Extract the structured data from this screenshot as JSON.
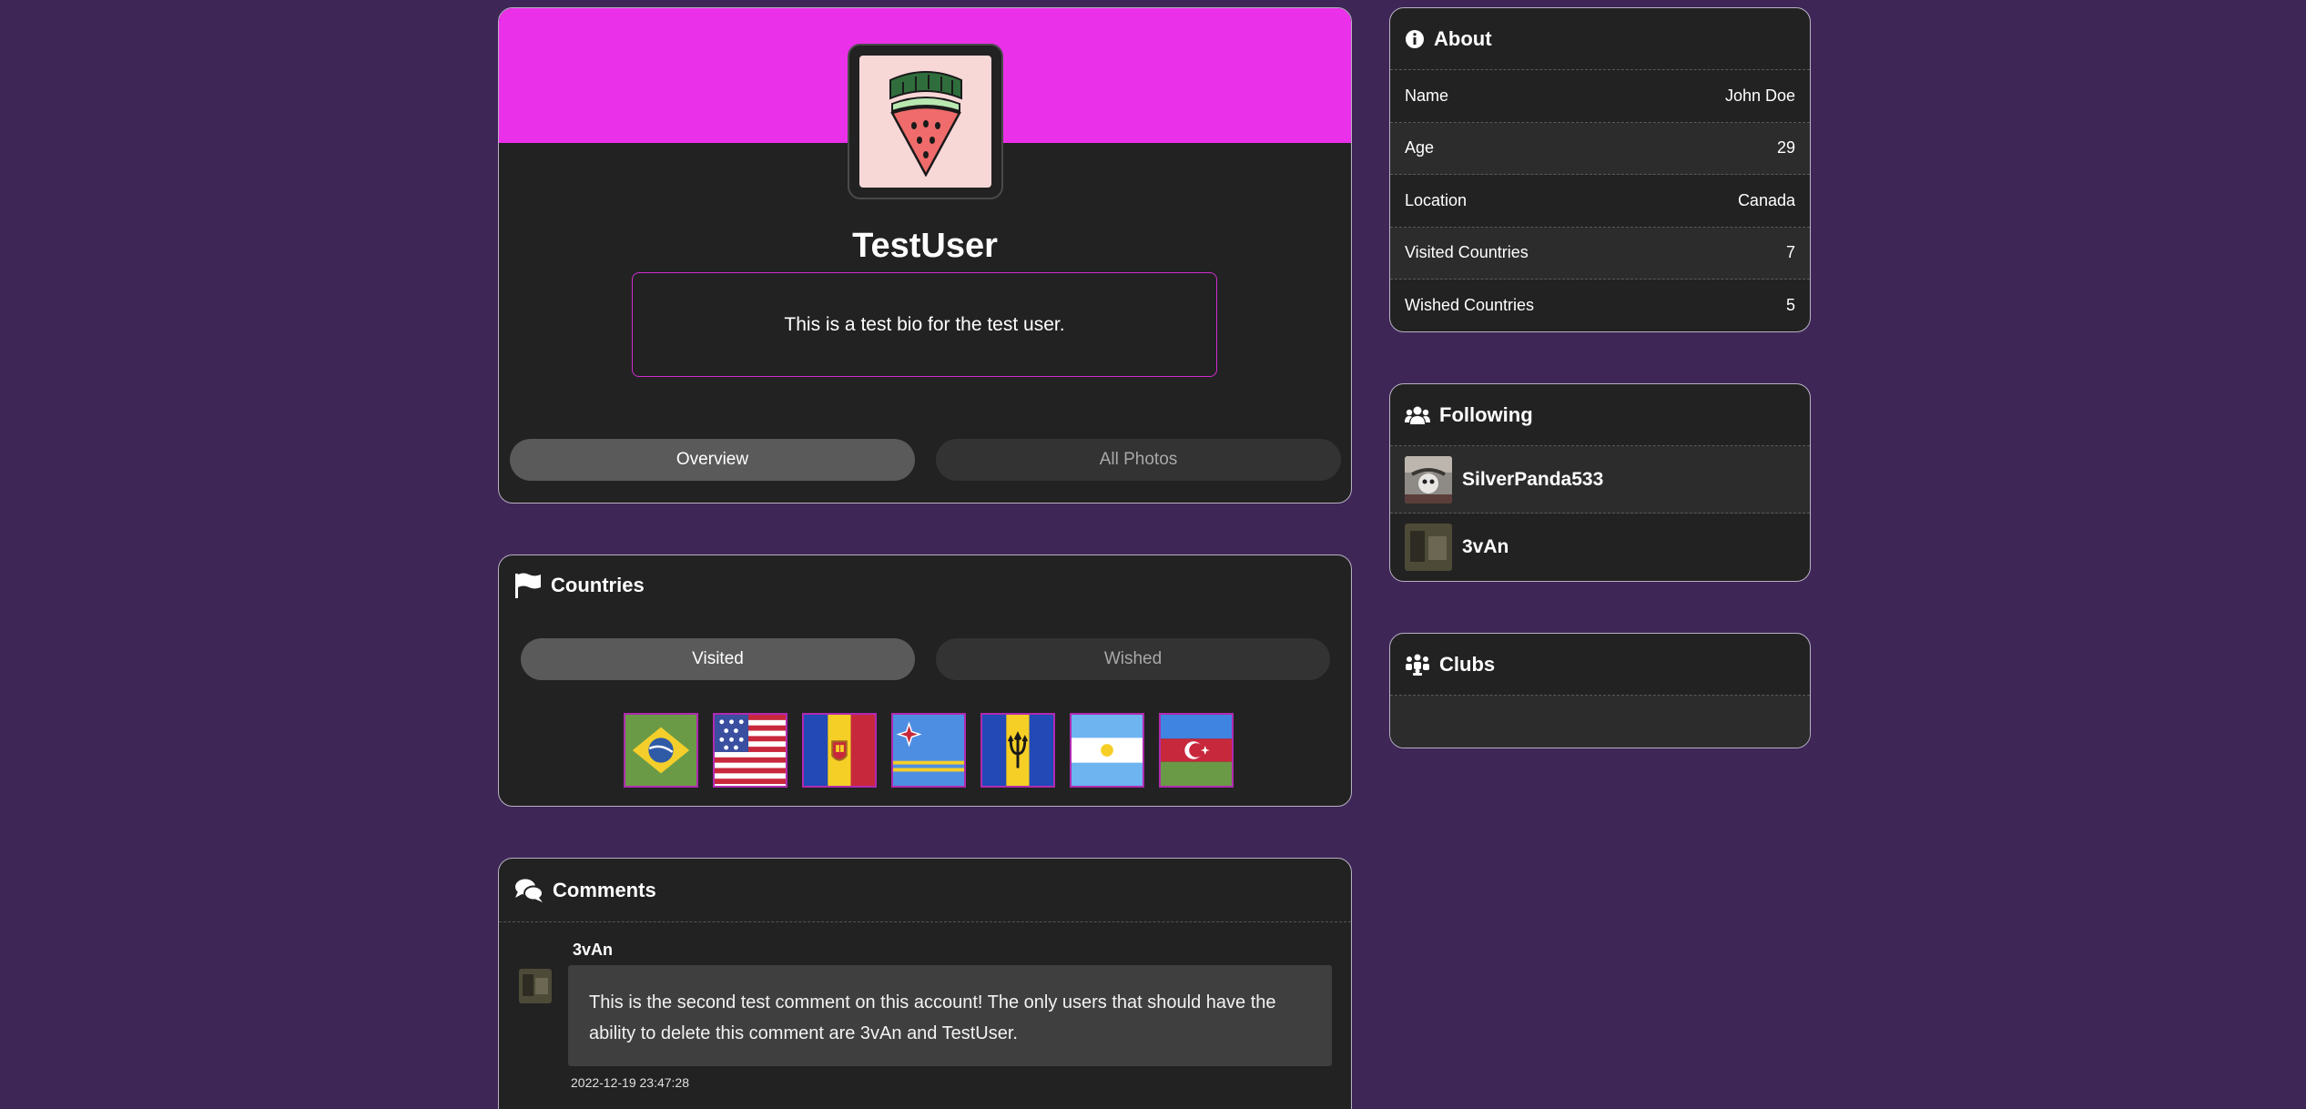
{
  "profile": {
    "avatar_icon": "watermelon-icon",
    "username": "TestUser",
    "bio": "This is a test bio for the test user.",
    "tabs": [
      "Overview",
      "All Photos"
    ],
    "active_tab": "Overview",
    "banner_color": "#ea30e8"
  },
  "countries": {
    "title": "Countries",
    "icon": "flag-icon",
    "tabs": [
      "Visited",
      "Wished"
    ],
    "active_tab": "Visited",
    "flags": [
      "Brazil",
      "United States",
      "Andorra",
      "Aruba",
      "Barbados",
      "Argentina",
      "Azerbaijan"
    ]
  },
  "comments": {
    "title": "Comments",
    "icon": "comments-icon",
    "items": [
      {
        "author": "3vAn",
        "text": "This is the second test comment on this account! The only users that should have the ability to delete this comment are 3vAn and TestUser.",
        "timestamp": "2022-12-19 23:47:28"
      }
    ]
  },
  "about": {
    "title": "About",
    "icon": "info-icon",
    "rows": [
      {
        "label": "Name",
        "value": "John Doe"
      },
      {
        "label": "Age",
        "value": "29"
      },
      {
        "label": "Location",
        "value": "Canada"
      },
      {
        "label": "Visited Countries",
        "value": "7"
      },
      {
        "label": "Wished Countries",
        "value": "5"
      }
    ]
  },
  "following": {
    "title": "Following",
    "icon": "users-icon",
    "users": [
      {
        "name": "SilverPanda533"
      },
      {
        "name": "3vAn"
      }
    ]
  },
  "clubs": {
    "title": "Clubs",
    "icon": "group-icon"
  }
}
